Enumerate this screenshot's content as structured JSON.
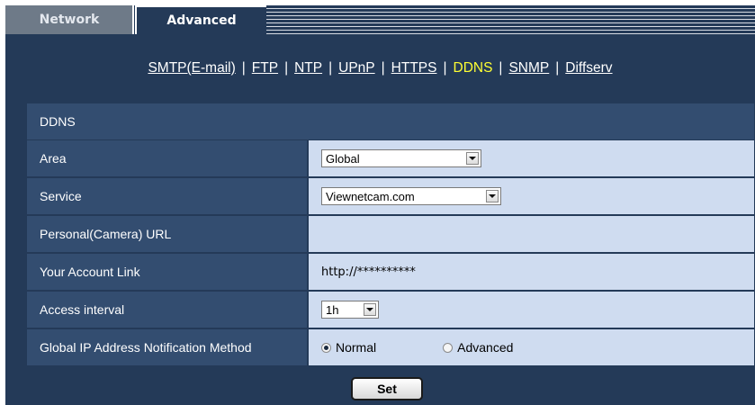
{
  "tabs": {
    "network": "Network",
    "advanced": "Advanced"
  },
  "nav": {
    "links": [
      "SMTP(E-mail)",
      "FTP",
      "NTP",
      "UPnP",
      "HTTPS",
      "DDNS",
      "SNMP",
      "Diffserv"
    ],
    "active": "DDNS",
    "separator": "|"
  },
  "section": {
    "title": "DDNS"
  },
  "rows": {
    "area": {
      "label": "Area",
      "value": "Global"
    },
    "service": {
      "label": "Service",
      "value": "Viewnetcam.com"
    },
    "personal_url": {
      "label": "Personal(Camera) URL",
      "value": ""
    },
    "account_link": {
      "label": "Your Account Link",
      "value": "http://**********"
    },
    "access_interval": {
      "label": "Access interval",
      "value": "1h"
    },
    "notification": {
      "label": "Global IP Address Notification Method",
      "options": [
        "Normal",
        "Advanced"
      ],
      "selected": "Normal"
    }
  },
  "buttons": {
    "set": "Set"
  },
  "colors": {
    "panel": "#243a58",
    "label_cell": "#334d70",
    "value_cell": "#cfdcf0",
    "active_link": "#ffff33"
  }
}
